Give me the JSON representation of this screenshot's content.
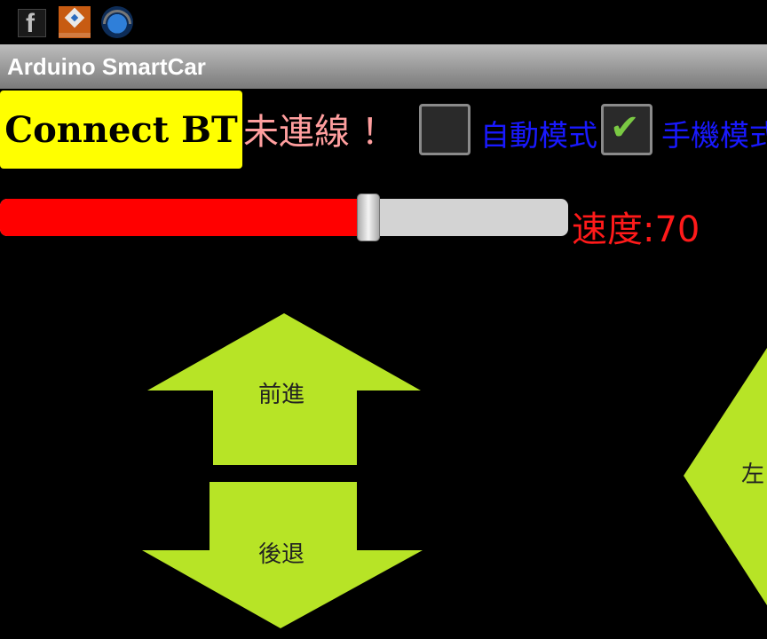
{
  "status_bar": {
    "icons": [
      "facebook-icon",
      "app-store-icon",
      "headphone-globe-icon"
    ]
  },
  "titlebar": {
    "title": "Arduino SmartCar"
  },
  "connect_button": {
    "label": "Connect BT"
  },
  "connection_status": "未連線 ！",
  "modes": {
    "auto": {
      "label": "自動模式",
      "checked": false
    },
    "phone": {
      "label": "手機模式",
      "checked": true
    }
  },
  "speed": {
    "label": "速度:70",
    "value": 70,
    "max": 108
  },
  "controls": {
    "forward": "前進",
    "backward": "後退",
    "left": "左"
  },
  "colors": {
    "background": "#000000",
    "connect_button": "#ffff00",
    "status_text": "#ff9e9e",
    "mode_label": "#1919ff",
    "slider_fill": "#ff0000",
    "speed_text": "#ff1a1a",
    "arrow": "#b7e426"
  }
}
